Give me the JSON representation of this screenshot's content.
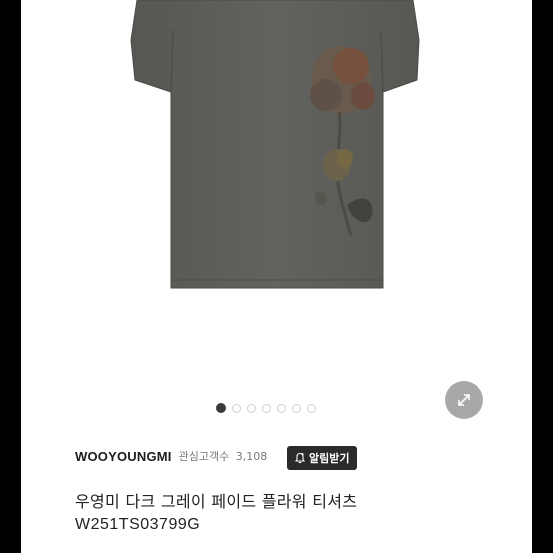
{
  "product": {
    "brand": "WOOYOUNGMI",
    "watchers_label": "관심고객수",
    "watchers_count": "3,108",
    "alert_button_label": "알림받기",
    "title": "우영미 다크 그레이 페이드 플라워 티셔츠",
    "code": "W251TS03799G"
  },
  "gallery": {
    "total_images": 7,
    "active_index": 1,
    "image_icon": "t-shirt-image",
    "expand_icon": "expand-arrows-icon"
  },
  "colors": {
    "shirt": "#5d5d5a",
    "accent_dark": "#2a2a2a",
    "expand_button": "#a8a8a8"
  }
}
